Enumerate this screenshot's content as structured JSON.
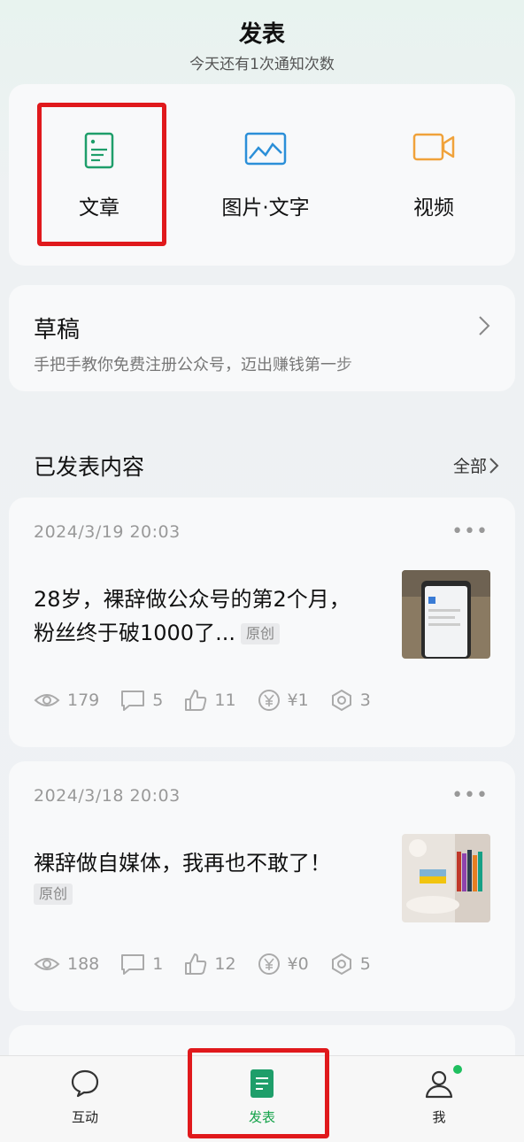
{
  "header": {
    "title": "发表",
    "subtitle": "今天还有1次通知次数"
  },
  "publish_options": [
    {
      "label": "文章",
      "icon": "article-icon"
    },
    {
      "label": "图片·文字",
      "icon": "image-text-icon"
    },
    {
      "label": "视频",
      "icon": "video-icon"
    }
  ],
  "draft": {
    "title": "草稿",
    "preview": "手把手教你免费注册公众号，迈出赚钱第一步"
  },
  "published": {
    "section_title": "已发表内容",
    "all_label": "全部",
    "posts": [
      {
        "date": "2024/3/19 20:03",
        "title": "28岁，裸辞做公众号的第2个月，粉丝终于破1000了...",
        "tag": "原创",
        "views": "179",
        "comments": "5",
        "likes": "11",
        "tips": "¥1",
        "shares": "3"
      },
      {
        "date": "2024/3/18 20:03",
        "title": "裸辞做自媒体，我再也不敢了！",
        "tag": "原创",
        "views": "188",
        "comments": "1",
        "likes": "12",
        "tips": "¥0",
        "shares": "5"
      }
    ]
  },
  "tabbar": {
    "items": [
      {
        "label": "互动"
      },
      {
        "label": "发表"
      },
      {
        "label": "我"
      }
    ]
  },
  "colors": {
    "accent_green": "#15a34a",
    "highlight_red": "#e0191c",
    "article_icon": "#1e9e6a",
    "image_icon": "#2b8fd8",
    "video_icon": "#f0a23a"
  }
}
